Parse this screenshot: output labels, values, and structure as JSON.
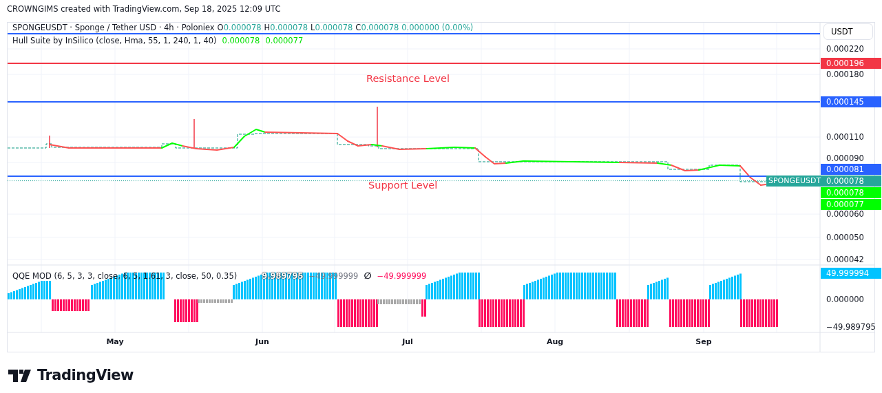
{
  "header": {
    "caption": "CROWNGIMS created with TradingView.com, Sep 18, 2025 12:09 UTC"
  },
  "chart": {
    "legend": {
      "symbol": "SPONGEUSDT · Sponge / Tether USD · 4h · Poloniex",
      "ohlc": [
        {
          "label": "O",
          "value": "0.000078"
        },
        {
          "label": "H",
          "value": "0.000078"
        },
        {
          "label": "L",
          "value": "0.000078"
        },
        {
          "label": "C",
          "value": "0.000078"
        }
      ],
      "change": "0.000000 (0.00%)"
    },
    "hull_legend": {
      "name": "Hull Suite by InSilico (close, Hma, 55, 1, 240, 1, 40)",
      "values": [
        "0.000078",
        "0.000077"
      ]
    },
    "annotations": [
      {
        "text": "Resistance Level"
      },
      {
        "text": "Support Level"
      }
    ],
    "price_axis": {
      "currency": "USDT",
      "ticks": [
        "0.000220",
        "0.000180",
        "0.000110",
        "0.000090",
        "0.000060",
        "0.000050",
        "0.000042"
      ]
    },
    "price_tags": [
      {
        "value": "0.000196",
        "color": "#f23645",
        "line": true
      },
      {
        "value": "0.000145",
        "color": "#2962ff",
        "line": true
      },
      {
        "value": "0.000081",
        "color": "#2962ff",
        "line": true
      },
      {
        "value": "0.000078",
        "color": "#26a69a",
        "line": false
      },
      {
        "value": "0.000078",
        "color": "#00ff00",
        "line": false
      },
      {
        "value": "0.000077",
        "color": "#00ff00",
        "line": false
      }
    ],
    "symbol_tag": "SPONGEUSDT",
    "indicator": {
      "legend": "QQE MOD (6, 5, 3, 3, close, 6, 5, 1.61, 3, close, 50, 0.35)",
      "values": [
        {
          "text": "9.989795"
        },
        {
          "text": "−49.999999",
          "color": "#787b86"
        },
        {
          "text": "∅"
        },
        {
          "text": "−49.999999",
          "color": "#ff0f5f"
        }
      ],
      "axis_tag": {
        "value": "49.999994",
        "color": "#00c3ff"
      },
      "ticks": [
        "0.000000",
        "−49.989795"
      ]
    },
    "time_axis": [
      "May",
      "Jun",
      "Jul",
      "Aug",
      "Sep"
    ]
  },
  "footer": {
    "logo": "TradingView"
  }
}
